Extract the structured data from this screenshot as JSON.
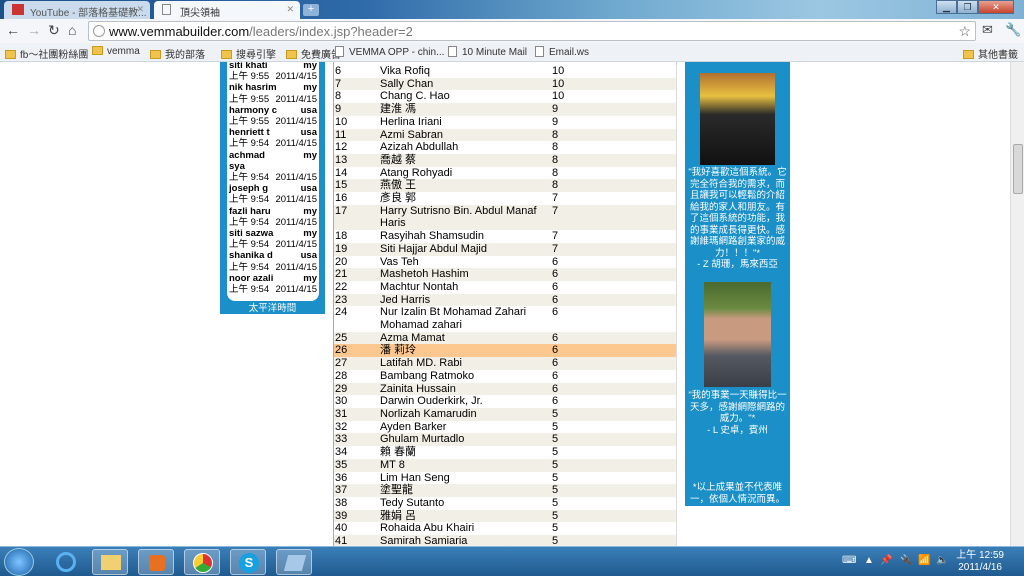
{
  "browser": {
    "tabs": [
      {
        "label": "YouTube - 部落格基礎教...",
        "active": false
      },
      {
        "label": "頂尖領袖",
        "active": true
      }
    ],
    "url_domain": "www.vemmabuilder.com",
    "url_path": "/leaders/index.jsp?header=2",
    "bookmarks": [
      {
        "label": "fb～社團粉絲團",
        "type": "folder"
      },
      {
        "label": "vemma",
        "type": "folder"
      },
      {
        "label": "我的部落",
        "type": "folder"
      },
      {
        "label": "搜尋引擎",
        "type": "folder"
      },
      {
        "label": "免費廣告",
        "type": "folder"
      },
      {
        "label": "VEMMA OPP - chin...",
        "type": "page"
      },
      {
        "label": "10 Minute Mail",
        "type": "page"
      },
      {
        "label": "Email.ws",
        "type": "page"
      }
    ],
    "other_bookmarks": "其他書籤"
  },
  "recent_signups": {
    "items": [
      {
        "name": "siti khati",
        "country": "my",
        "time": "上午 9:55",
        "date": "2011/4/15"
      },
      {
        "name": "nik hasrim",
        "country": "my",
        "time": "上午 9:55",
        "date": "2011/4/15"
      },
      {
        "name": "harmony c",
        "country": "usa",
        "time": "上午 9:55",
        "date": "2011/4/15"
      },
      {
        "name": "henriett t",
        "country": "usa",
        "time": "上午 9:54",
        "date": "2011/4/15"
      },
      {
        "name": "achmad sya",
        "country": "my",
        "time": "上午 9:54",
        "date": "2011/4/15"
      },
      {
        "name": "joseph g",
        "country": "usa",
        "time": "上午 9:54",
        "date": "2011/4/15"
      },
      {
        "name": "fazli haru",
        "country": "my",
        "time": "上午 9:54",
        "date": "2011/4/15"
      },
      {
        "name": "siti sazwa",
        "country": "my",
        "time": "上午 9:54",
        "date": "2011/4/15"
      },
      {
        "name": "shanika d",
        "country": "usa",
        "time": "上午 9:54",
        "date": "2011/4/15"
      },
      {
        "name": "noor azali",
        "country": "my",
        "time": "上午 9:54",
        "date": "2011/4/15"
      }
    ],
    "timezone_label": "太平洋時間"
  },
  "leaders": {
    "highlight_rank": "26",
    "rows": [
      [
        "6",
        "Vika Rofiq",
        "10"
      ],
      [
        "7",
        "Sally Chan",
        "10"
      ],
      [
        "8",
        "Chang C. Hao",
        "10"
      ],
      [
        "9",
        "建淮 馮",
        "9"
      ],
      [
        "10",
        "Herlina Iriani",
        "9"
      ],
      [
        "11",
        "Azmi Sabran",
        "8"
      ],
      [
        "12",
        "Azizah Abdullah",
        "8"
      ],
      [
        "13",
        "喬越 蔡",
        "8"
      ],
      [
        "14",
        "Atang Rohyadi",
        "8"
      ],
      [
        "15",
        "燕傲 王",
        "8"
      ],
      [
        "16",
        "彥良 郭",
        "7"
      ],
      [
        "17",
        "Harry Sutrisno Bin. Abdul Manaf Haris",
        "7"
      ],
      [
        "18",
        "Rasyihah Shamsudin",
        "7"
      ],
      [
        "19",
        "Siti Hajjar Abdul Majid",
        "7"
      ],
      [
        "20",
        "Vas Teh",
        "6"
      ],
      [
        "21",
        "Mashetoh Hashim",
        "6"
      ],
      [
        "22",
        "Machtur Nontah",
        "6"
      ],
      [
        "23",
        "Jed Harris",
        "6"
      ],
      [
        "24",
        "Nur Izalin Bt Mohamad Zahari Mohamad zahari",
        "6"
      ],
      [
        "25",
        "Azma Mamat",
        "6"
      ],
      [
        "26",
        "潘 莉玲",
        "6"
      ],
      [
        "27",
        "Latifah MD. Rabi",
        "6"
      ],
      [
        "28",
        "Bambang Ratmoko",
        "6"
      ],
      [
        "29",
        "Zainita Hussain",
        "6"
      ],
      [
        "30",
        "Darwin Ouderkirk, Jr.",
        "6"
      ],
      [
        "31",
        "Norlizah Kamarudin",
        "5"
      ],
      [
        "32",
        "Ayden Barker",
        "5"
      ],
      [
        "33",
        "Ghulam Murtadlo",
        "5"
      ],
      [
        "34",
        "賴 春蘭",
        "5"
      ],
      [
        "35",
        "MT 8",
        "5"
      ],
      [
        "36",
        "Lim Han Seng",
        "5"
      ],
      [
        "37",
        "塗聖龍",
        "5"
      ],
      [
        "38",
        "Tedy Sutanto",
        "5"
      ],
      [
        "39",
        "雅娟 呂",
        "5"
      ],
      [
        "40",
        "Rohaida Abu Khairi",
        "5"
      ],
      [
        "41",
        "Samirah Samiaria",
        "5"
      ]
    ]
  },
  "testimonials": [
    {
      "quote": "\"我好喜歡這個系統。它完全符合我的需求，而且讓我可以輕鬆的介紹給我的家人和朋友。有了這個系統的功能，我的事業成長得更快。感謝維瑪網路創業家的威力！！！\"*",
      "author": "- Z 胡珊，馬來西亞"
    },
    {
      "quote": "\"我的事業一天賺得比一天多，感謝網際網路的威力。\"*",
      "author": "- L 史卓，賓州"
    }
  ],
  "disclaimer": "*以上成果並不代表唯一，依個人情況而異。",
  "taskbar": {
    "time": "上午 12:59",
    "date": "2011/4/16"
  },
  "colors": {
    "panel_blue": "#1a8fc8",
    "row_alt": "#f2efe6",
    "row_highlight": "#fcc88f"
  }
}
